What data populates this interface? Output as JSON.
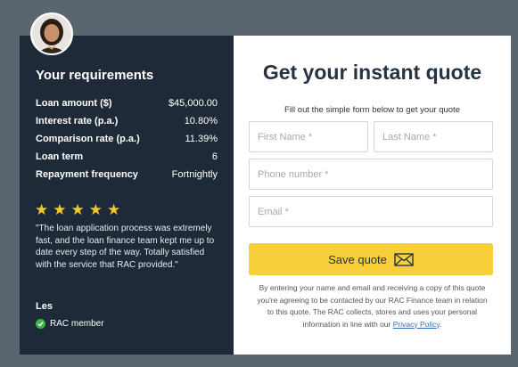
{
  "requirements": {
    "title": "Your requirements",
    "rows": [
      {
        "label": "Loan amount ($)",
        "value": "$45,000.00"
      },
      {
        "label": "Interest rate (p.a.)",
        "value": "10.80%"
      },
      {
        "label": "Comparison rate (p.a.)",
        "value": "11.39%"
      },
      {
        "label": "Loan term",
        "value": "6"
      },
      {
        "label": "Repayment frequency",
        "value": "Fortnightly"
      }
    ]
  },
  "testimonial": {
    "rating": 5,
    "star_char": "★",
    "quote": "\"The loan application process was extremely fast, and the loan finance team kept me up to date every step of the way. Totally satisfied with the service that RAC provided.\"",
    "author": "Les",
    "badge": "RAC member"
  },
  "form": {
    "title": "Get your instant quote",
    "subtitle": "Fill out the simple form below to get your quote",
    "first_name_placeholder": "First Name *",
    "last_name_placeholder": "Last Name *",
    "phone_placeholder": "Phone number *",
    "email_placeholder": "Email *",
    "submit_label": "Save quote",
    "disclaimer": "By entering your name and email and receiving a copy of this quote you're agreeing to be contacted by our RAC Finance team in relation to this quote. The RAC collects, stores and uses your personal information in line with our ",
    "privacy_link": "Privacy Policy",
    "disclaimer_end": "."
  },
  "colors": {
    "panel_dark": "#1f2a38",
    "accent_yellow": "#f6cf3b",
    "star_yellow": "#f3c92a",
    "check_green": "#3fb54a",
    "background": "#5b6570"
  },
  "icons": {
    "avatar": "person-avatar",
    "star": "star-icon",
    "check": "check-circle-icon",
    "submit": "envelope-icon"
  }
}
